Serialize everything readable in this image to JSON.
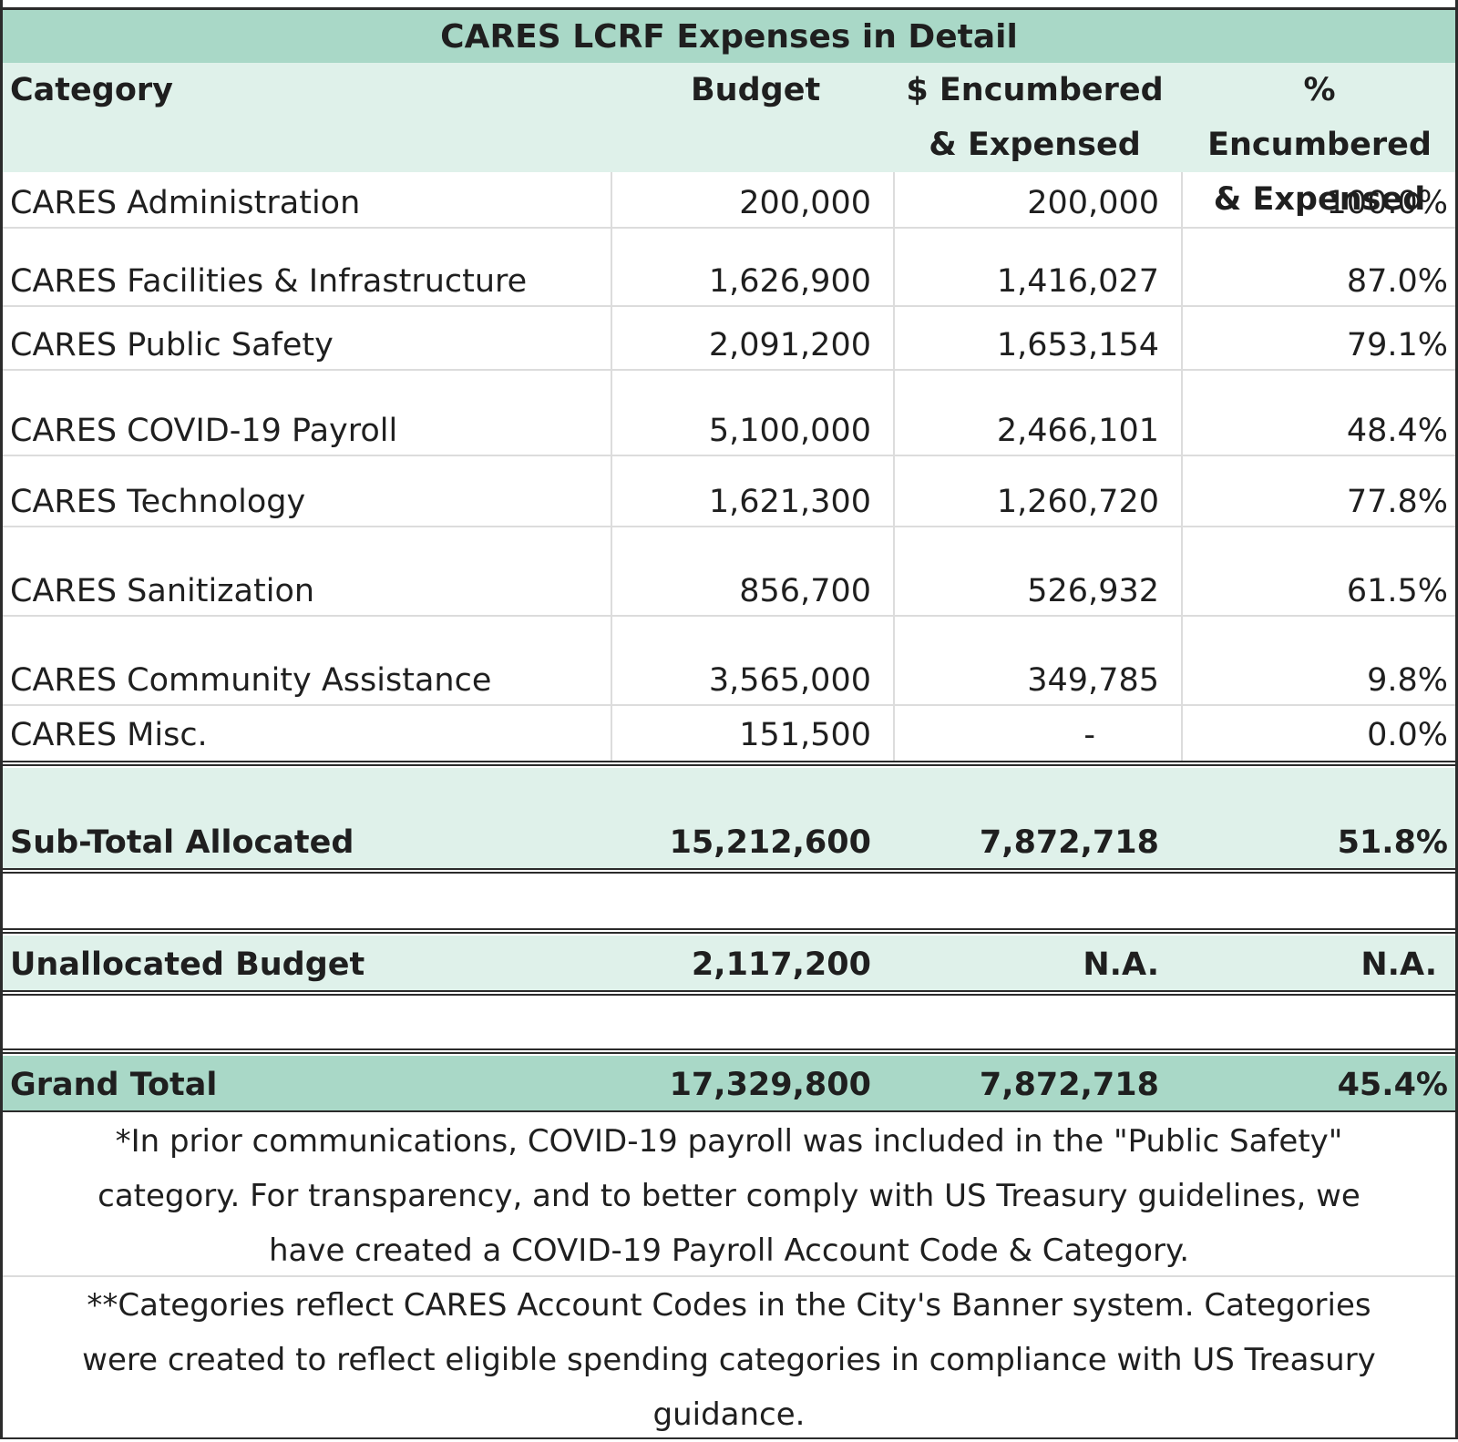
{
  "title": "CARES LCRF Expenses in Detail",
  "headers": {
    "category": "Category",
    "budget": "Budget",
    "encumbered_line1": "$ Encumbered",
    "encumbered_line2": "& Expensed",
    "pct_line1": "% Encumbered",
    "pct_line2": "& Expensed"
  },
  "rows": [
    {
      "category": "CARES Administration",
      "budget": "200,000",
      "encumbered": "200,000",
      "pct": "100.0%"
    },
    {
      "category": "CARES Facilities & Infrastructure",
      "budget": "1,626,900",
      "encumbered": "1,416,027",
      "pct": "87.0%"
    },
    {
      "category": "CARES Public Safety",
      "budget": "2,091,200",
      "encumbered": "1,653,154",
      "pct": "79.1%"
    },
    {
      "category": "CARES COVID-19 Payroll",
      "budget": "5,100,000",
      "encumbered": "2,466,101",
      "pct": "48.4%"
    },
    {
      "category": "CARES Technology",
      "budget": "1,621,300",
      "encumbered": "1,260,720",
      "pct": "77.8%"
    },
    {
      "category": "CARES Sanitization",
      "budget": "856,700",
      "encumbered": "526,932",
      "pct": "61.5%"
    },
    {
      "category": "CARES Community Assistance",
      "budget": "3,565,000",
      "encumbered": "349,785",
      "pct": "9.8%"
    },
    {
      "category": "CARES Misc.",
      "budget": "151,500",
      "encumbered": "-",
      "pct": "0.0%"
    }
  ],
  "subtotal": {
    "label": "Sub-Total Allocated",
    "budget": "15,212,600",
    "encumbered": "7,872,718",
    "pct": "51.8%"
  },
  "unallocated": {
    "label": "Unallocated Budget",
    "budget": "2,117,200",
    "encumbered": "N.A.",
    "pct": "N.A."
  },
  "grand_total": {
    "label": "Grand Total",
    "budget": "17,329,800",
    "encumbered": "7,872,718",
    "pct": "45.4%"
  },
  "notes": {
    "note1_line1": "*In prior communications, COVID-19 payroll was included in the \"Public Safety\"",
    "note1_line2": "category. For transparency, and to better comply with US Treasury guidelines, we",
    "note1_line3": "have created a COVID-19 Payroll Account Code & Category.",
    "note2_line1": "**Categories reflect CARES Account Codes in the City's Banner system. Categories",
    "note2_line2": "were created to reflect eligible spending categories in compliance with US Treasury",
    "note2_line3": "guidance."
  },
  "colors": {
    "title_band": "#a9d8c7",
    "header_band": "#dff1ea",
    "border": "#2b2b2b",
    "gridline": "#dcdcdc"
  }
}
